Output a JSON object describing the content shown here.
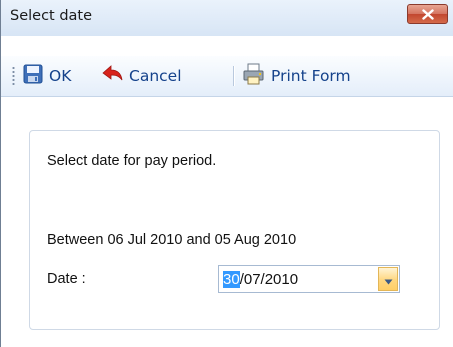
{
  "window": {
    "title": "Select date",
    "close_icon": "close-icon"
  },
  "toolbar": {
    "ok_label": "OK",
    "ok_icon": "save-icon",
    "cancel_label": "Cancel",
    "cancel_icon": "back-arrow-icon",
    "print_label": "Print Form",
    "print_icon": "print-form-icon"
  },
  "form": {
    "instruction": "Select date for pay period.",
    "range_text": "Between 06 Jul 2010 and 05 Aug 2010",
    "date_label": "Date :",
    "date_value_selected": "30",
    "date_value_rest": "/07/2010",
    "dropdown_icon": "chevron-down-icon"
  },
  "colors": {
    "toolbar_text": "#15428b",
    "selection": "#3399ff",
    "close_button": "#c2472f",
    "dropdown_button": "#ffd780"
  }
}
